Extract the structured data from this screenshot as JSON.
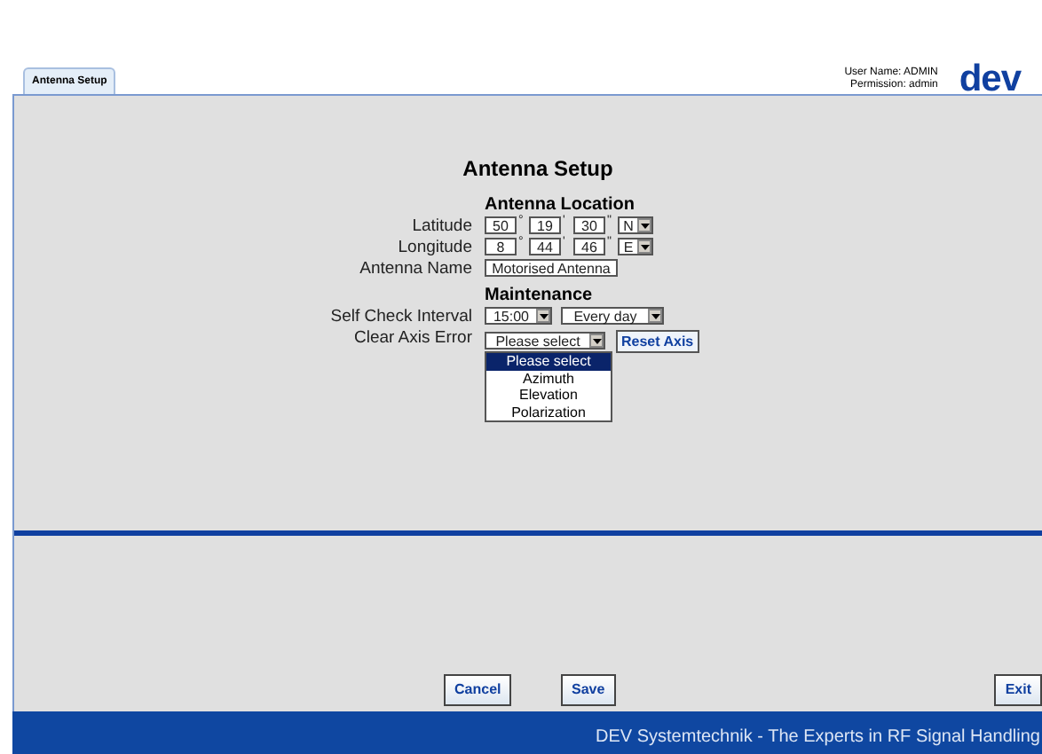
{
  "tabs": [
    {
      "label": "Antenna Setup",
      "selected": true
    }
  ],
  "user": {
    "name_line": "User Name: ADMIN",
    "permission_line": "Permission: admin"
  },
  "logo": "dev",
  "title": "Antenna Setup",
  "location": {
    "heading": "Antenna Location",
    "coords": [
      {
        "label": "Latitude",
        "deg": "50",
        "min": "19",
        "sec": "30",
        "hemisphere": "N",
        "marks": [
          "°",
          "'",
          "\""
        ]
      },
      {
        "label": "Longitude",
        "deg": "8",
        "min": "44",
        "sec": "46",
        "hemisphere": "E",
        "marks": [
          "°",
          "'",
          "\""
        ]
      }
    ],
    "antenna_name": {
      "label": "Antenna Name",
      "value": "Motorised Antenna"
    }
  },
  "maintenance": {
    "heading": "Maintenance",
    "self_check": {
      "label": "Self Check Interval",
      "time": "15:00",
      "frequency": "Every day"
    },
    "clear_axis": {
      "label": "Clear Axis Error",
      "value": "Please select",
      "button": "Reset Axis",
      "expanded": true,
      "options": [
        {
          "label": "Please select",
          "selected": true
        },
        {
          "label": "Azimuth",
          "selected": false
        },
        {
          "label": "Elevation",
          "selected": false
        },
        {
          "label": "Polarization",
          "selected": false
        }
      ]
    }
  },
  "buttons": [
    {
      "label": "Cancel"
    },
    {
      "label": "Save"
    },
    {
      "label": "Exit"
    }
  ],
  "footer": "DEV Systemtechnik - The Experts in RF Signal Handling"
}
